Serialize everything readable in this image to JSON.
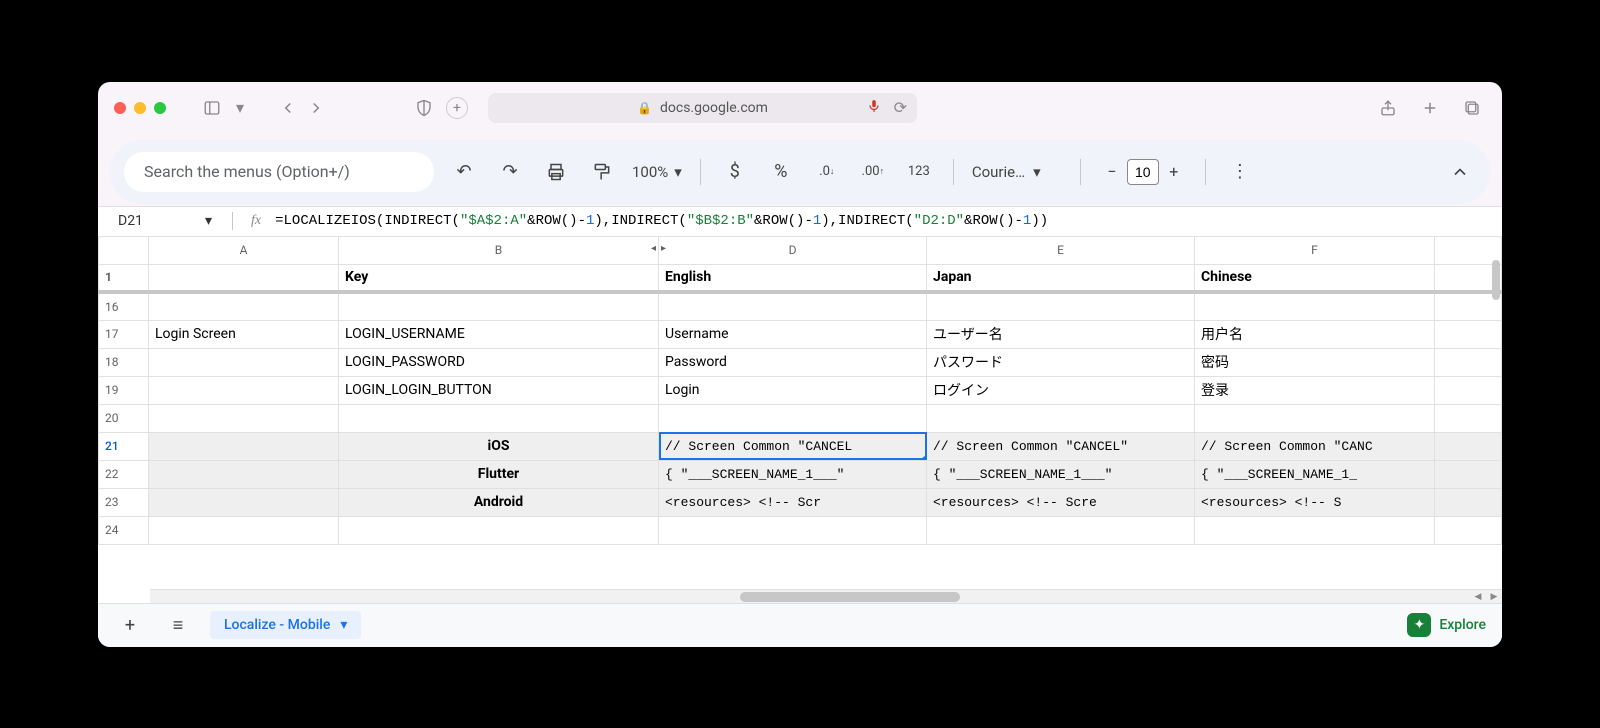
{
  "browser": {
    "url": "docs.google.com"
  },
  "toolbar": {
    "search_placeholder": "Search the menus (Option+/)",
    "zoom": "100%",
    "font_name": "Courie…",
    "font_size": "10"
  },
  "formula_bar": {
    "cell_ref": "D21",
    "formula_prefix": "=LOCALIZEIOS(INDIRECT(",
    "formula_str1": "\"$A$2:A\"",
    "formula_mid1": "&ROW()-",
    "formula_num1": "1",
    "formula_mid2": "),INDIRECT(",
    "formula_str2": "\"$B$2:B\"",
    "formula_mid3": "&ROW()-",
    "formula_num2": "1",
    "formula_mid4": "),INDIRECT(",
    "formula_str3": "\"D2:D\"",
    "formula_mid5": "&ROW()-",
    "formula_num3": "1",
    "formula_end": "))"
  },
  "columns": {
    "A": "A",
    "B": "B",
    "D": "D",
    "E": "E",
    "F": "F"
  },
  "header_row": {
    "num": "1",
    "key": "Key",
    "english": "English",
    "japan": "Japan",
    "chinese": "Chinese"
  },
  "rows": [
    {
      "num": "16",
      "A": "",
      "B": "",
      "D": "",
      "E": "",
      "F": ""
    },
    {
      "num": "17",
      "A": "Login Screen",
      "B": "LOGIN_USERNAME",
      "D": "Username",
      "E": "ユーザー名",
      "F": "用户名"
    },
    {
      "num": "18",
      "A": "",
      "B": "LOGIN_PASSWORD",
      "D": "Password",
      "E": "パスワード",
      "F": "密码"
    },
    {
      "num": "19",
      "A": "",
      "B": "LOGIN_LOGIN_BUTTON",
      "D": "Login",
      "E": "ログイン",
      "F": "登录"
    },
    {
      "num": "20",
      "A": "",
      "B": "",
      "D": "",
      "E": "",
      "F": ""
    }
  ],
  "gray_rows": [
    {
      "num": "21",
      "B": "iOS",
      "D": " // Screen Common \"CANCEL",
      "E": " // Screen Common \"CANCEL\"",
      "F": " // Screen Common \"CANC"
    },
    {
      "num": "22",
      "B": "Flutter",
      "D": "{    \"___SCREEN_NAME_1___\"",
      "E": "{    \"___SCREEN_NAME_1___\"",
      "F": "{    \"___SCREEN_NAME_1_"
    },
    {
      "num": "23",
      "B": "Android",
      "D": "<resources>     <!-- Scr",
      "E": "<resources>     <!-- Scre",
      "F": "<resources>     <!-- S"
    }
  ],
  "trailing_row": {
    "num": "24"
  },
  "bottom": {
    "tab_label": "Localize - Mobile",
    "explore": "Explore"
  }
}
